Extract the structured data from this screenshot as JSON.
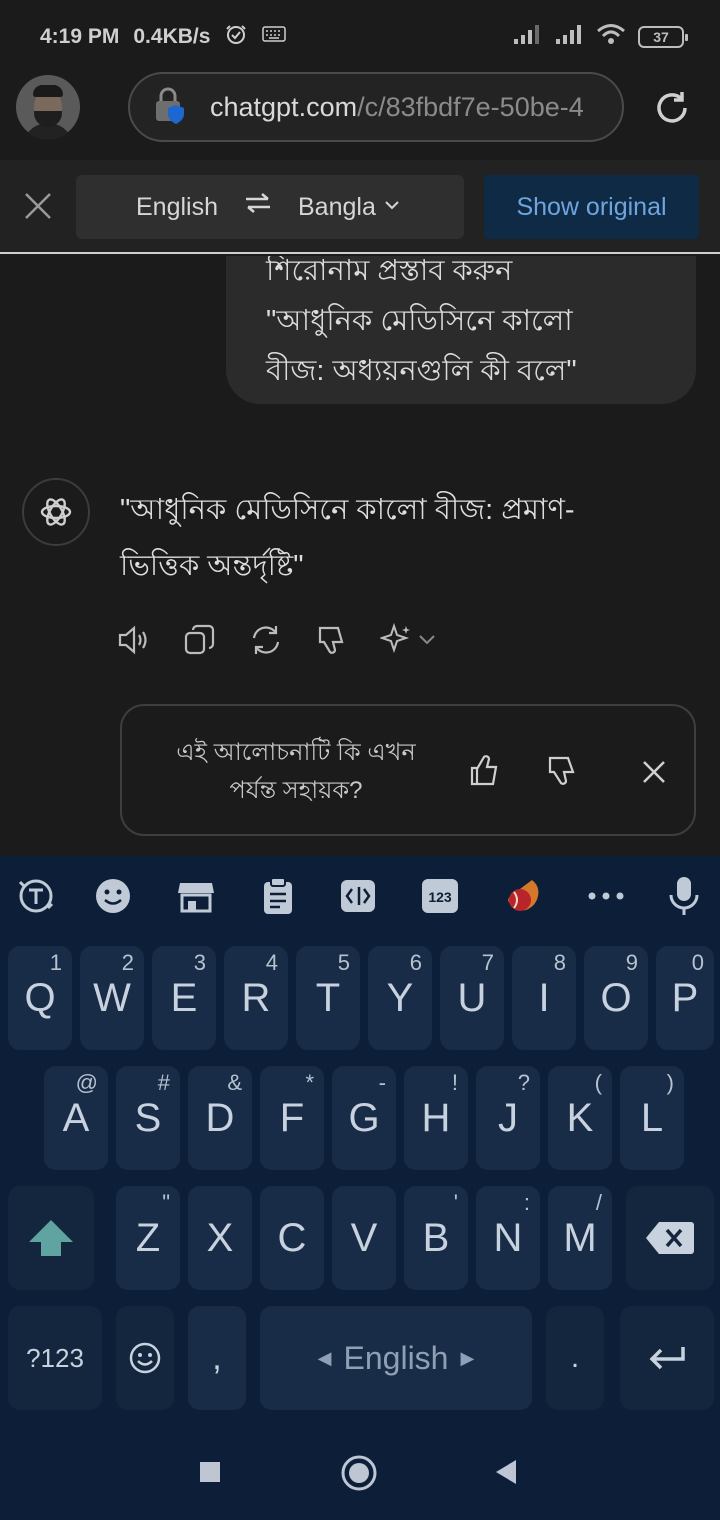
{
  "status_bar": {
    "time": "4:19 PM",
    "speed": "0.4KB/s",
    "battery": "37"
  },
  "browser": {
    "url_host": "chatgpt.com",
    "url_path": "/c/83fbdf7e-50be-4"
  },
  "translate_bar": {
    "source_lang": "English",
    "target_lang": "Bangla",
    "show_original": "Show original"
  },
  "chat": {
    "user_message_lines": [
      "শিরোনাম প্রস্তাব করুন",
      "\"আধুনিক মেডিসিনে কালো",
      "বীজ: অধ্যয়নগুলি কী বলে\""
    ],
    "assistant_message_lines": [
      "\"আধুনিক মেডিসিনে কালো বীজ: প্রমাণ-",
      "ভিত্তিক অন্তর্দৃষ্টি\""
    ],
    "feedback_question_lines": [
      "এই আলোচনাটি কি এখন",
      "পর্যন্ত সহায়ক?"
    ]
  },
  "keyboard": {
    "row1": [
      {
        "key": "Q",
        "hint": "1"
      },
      {
        "key": "W",
        "hint": "2"
      },
      {
        "key": "E",
        "hint": "3"
      },
      {
        "key": "R",
        "hint": "4"
      },
      {
        "key": "T",
        "hint": "5"
      },
      {
        "key": "Y",
        "hint": "6"
      },
      {
        "key": "U",
        "hint": "7"
      },
      {
        "key": "I",
        "hint": "8"
      },
      {
        "key": "O",
        "hint": "9"
      },
      {
        "key": "P",
        "hint": "0"
      }
    ],
    "row2": [
      {
        "key": "A",
        "hint": "@"
      },
      {
        "key": "S",
        "hint": "#"
      },
      {
        "key": "D",
        "hint": "&"
      },
      {
        "key": "F",
        "hint": "*"
      },
      {
        "key": "G",
        "hint": "-"
      },
      {
        "key": "H",
        "hint": "!"
      },
      {
        "key": "J",
        "hint": "?"
      },
      {
        "key": "K",
        "hint": "("
      },
      {
        "key": "L",
        "hint": ")"
      }
    ],
    "row3": [
      {
        "key": "Z",
        "hint": "\""
      },
      {
        "key": "X",
        "hint": ""
      },
      {
        "key": "C",
        "hint": ""
      },
      {
        "key": "V",
        "hint": ""
      },
      {
        "key": "B",
        "hint": "'"
      },
      {
        "key": "N",
        "hint": ":"
      },
      {
        "key": "M",
        "hint": "/"
      }
    ],
    "symbols_key": "?123",
    "comma_key": ",",
    "space_label": "English",
    "period_key": ".",
    "toolbar_numbers": "123"
  },
  "icons": {
    "status": [
      "watch-icon",
      "keyboard-icon",
      "signal-icon",
      "signal-icon",
      "wifi-icon",
      "battery-icon"
    ],
    "toolbar": [
      "translate-icon",
      "emoji-icon",
      "store-icon",
      "clipboard-icon",
      "text-edit-icon",
      "numbers-icon",
      "game-icon",
      "more-icon",
      "mic-icon"
    ],
    "accent_blue": "#6fa5df",
    "shift_color": "#5fa4a0"
  }
}
